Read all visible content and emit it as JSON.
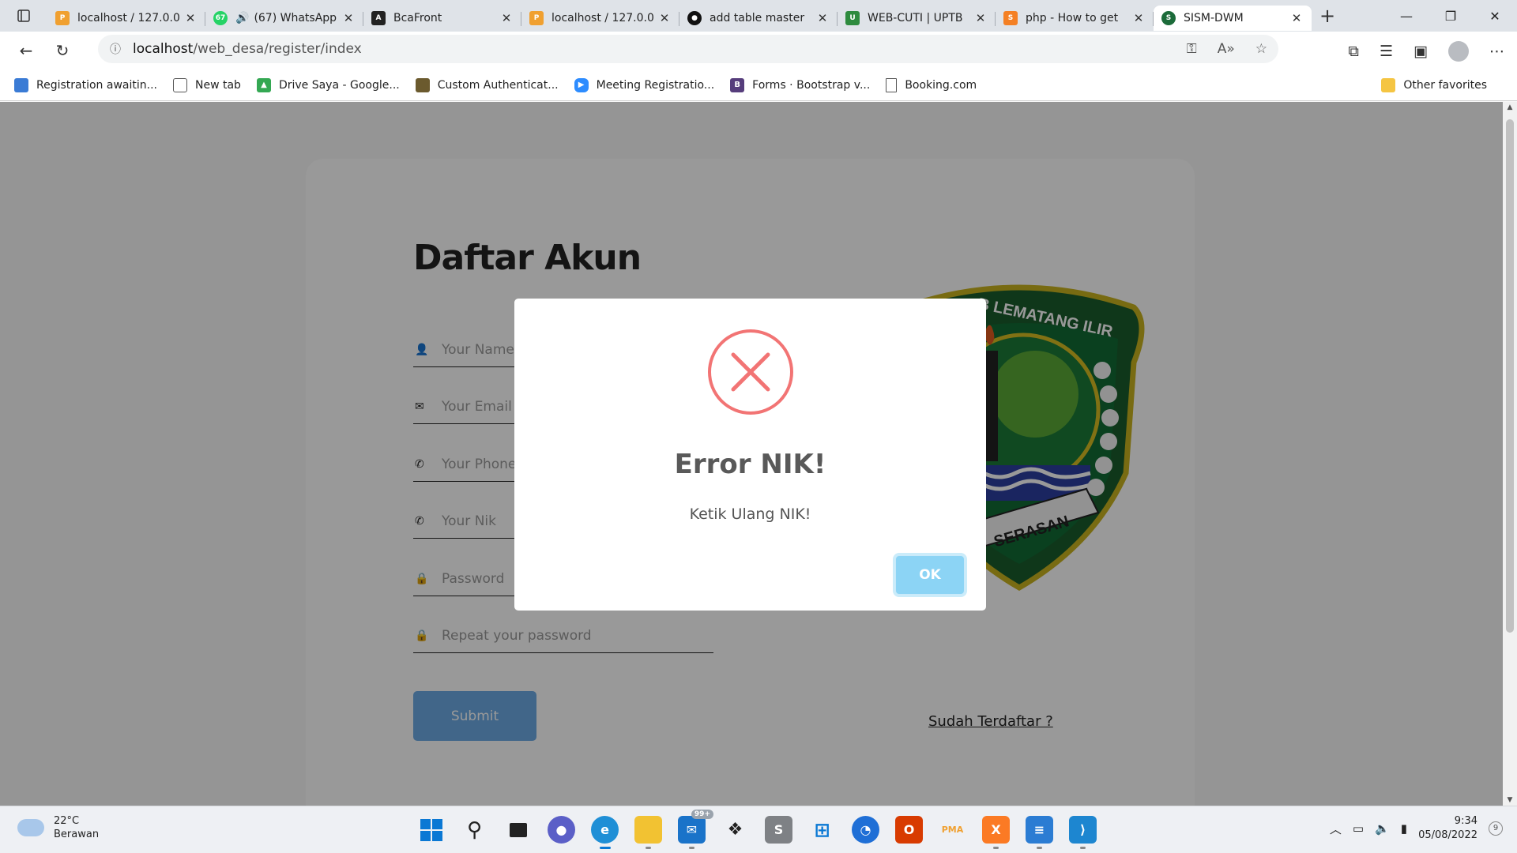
{
  "browser": {
    "tabs": [
      {
        "title": "localhost / 127.0.0",
        "favicon": "phpmyadmin-icon",
        "color": "#f0a030"
      },
      {
        "title": "(67) WhatsApp",
        "favicon": "whatsapp-icon",
        "color": "#25d366",
        "badge": "67"
      },
      {
        "title": "BcaFront",
        "favicon": "angular-icon",
        "color": "#222222"
      },
      {
        "title": "localhost / 127.0.0",
        "favicon": "phpmyadmin-icon",
        "color": "#f0a030"
      },
      {
        "title": "add table master",
        "favicon": "github-icon",
        "color": "#111111"
      },
      {
        "title": "WEB-CUTI | UPTB",
        "favicon": "uptb-icon",
        "color": "#2e8b3e"
      },
      {
        "title": "php - How to get",
        "favicon": "stackoverflow-icon",
        "color": "#f48024"
      },
      {
        "title": "SISM-DWM",
        "favicon": "sism-icon",
        "color": "#1c6b3a",
        "active": true
      }
    ],
    "url_host": "localhost",
    "url_path": "/web_desa/register/index",
    "bookmarks": [
      {
        "label": "Registration awaitin...",
        "color": "#3a7bd5"
      },
      {
        "label": "New tab",
        "color": "#555555"
      },
      {
        "label": "Drive Saya - Google...",
        "color": "#34a853"
      },
      {
        "label": "Custom Authenticat...",
        "color": "#6b5a2e"
      },
      {
        "label": "Meeting Registratio...",
        "color": "#2d8cff"
      },
      {
        "label": "Forms · Bootstrap v...",
        "color": "#563d7c"
      },
      {
        "label": "Booking.com",
        "color": "#888888"
      }
    ],
    "other_favorites": "Other favorites"
  },
  "page": {
    "title": "Daftar Akun",
    "fields": [
      {
        "placeholder": "Your Name",
        "icon": "user-icon"
      },
      {
        "placeholder": "Your Email",
        "icon": "mail-icon"
      },
      {
        "placeholder": "Your Phone",
        "icon": "phone-icon"
      },
      {
        "placeholder": "Your Nik",
        "icon": "phone-icon"
      },
      {
        "placeholder": "Password",
        "icon": "lock-icon"
      },
      {
        "placeholder": "Repeat your password",
        "icon": "lock-icon"
      }
    ],
    "submit_label": "Submit",
    "login_link": "Sudah Terdaftar ?",
    "emblem_text_top": "B LEMATANG ILIR",
    "emblem_text_bottom": "SERASAN"
  },
  "modal": {
    "title": "Error NIK!",
    "text": "Ketik Ulang NIK!",
    "ok_label": "OK",
    "icon": "error-x-icon",
    "accent": "#f27474"
  },
  "taskbar": {
    "weather_temp": "22°C",
    "weather_desc": "Berawan",
    "mail_badge": "99+",
    "time": "9:34",
    "date": "05/08/2022",
    "notif_count": "9"
  }
}
